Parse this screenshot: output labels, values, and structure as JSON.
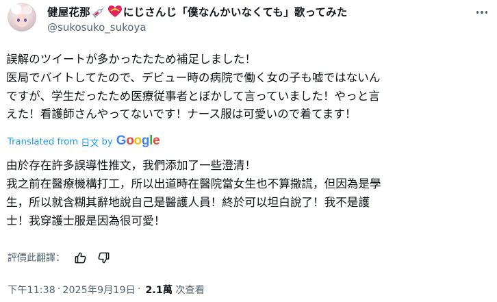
{
  "author": {
    "display_name_part1": "健屋花那",
    "display_name_part2": "にじさんじ「僕なんかいなくても」歌ってみた",
    "handle": "@sukosuko_sukoya",
    "emojis": [
      "syringe-icon",
      "heart-ribbon-icon"
    ]
  },
  "tweet": {
    "lines": [
      "誤解のツイートが多かったたため補足しました！",
      "医局でバイトしてたので、デビュー時の病院で働く女の子も嘘ではないん",
      "ですが、学生だったため医療従事者とぼかして言っていました！やっと言",
      "えた！看護師さんやってないです！ナース服は可愛いので着てます！"
    ]
  },
  "translation": {
    "label": "Translated from",
    "language": "日文",
    "by": "by",
    "provider": "Google",
    "lines": [
      "由於存在許多誤導性推文，我們添加了一些澄清！",
      "我之前在醫療機構打工，所以出道時在醫院當女生也不算撒謊，但因為是學",
      "生，所以就含糊其辭地說自己是醫護人員！終於可以坦白說了！我不是護",
      "士！我穿護士服是因為很可愛！"
    ],
    "rate_label": "評價此翻譯："
  },
  "meta": {
    "time": "下午11:38",
    "separator": "·",
    "date": "2025年9月19日",
    "views_count": "2.1萬",
    "views_label": "次查看"
  },
  "colors": {
    "link_blue": "#1d9bf0",
    "secondary_text": "#536471",
    "primary_text": "#0f1419"
  }
}
